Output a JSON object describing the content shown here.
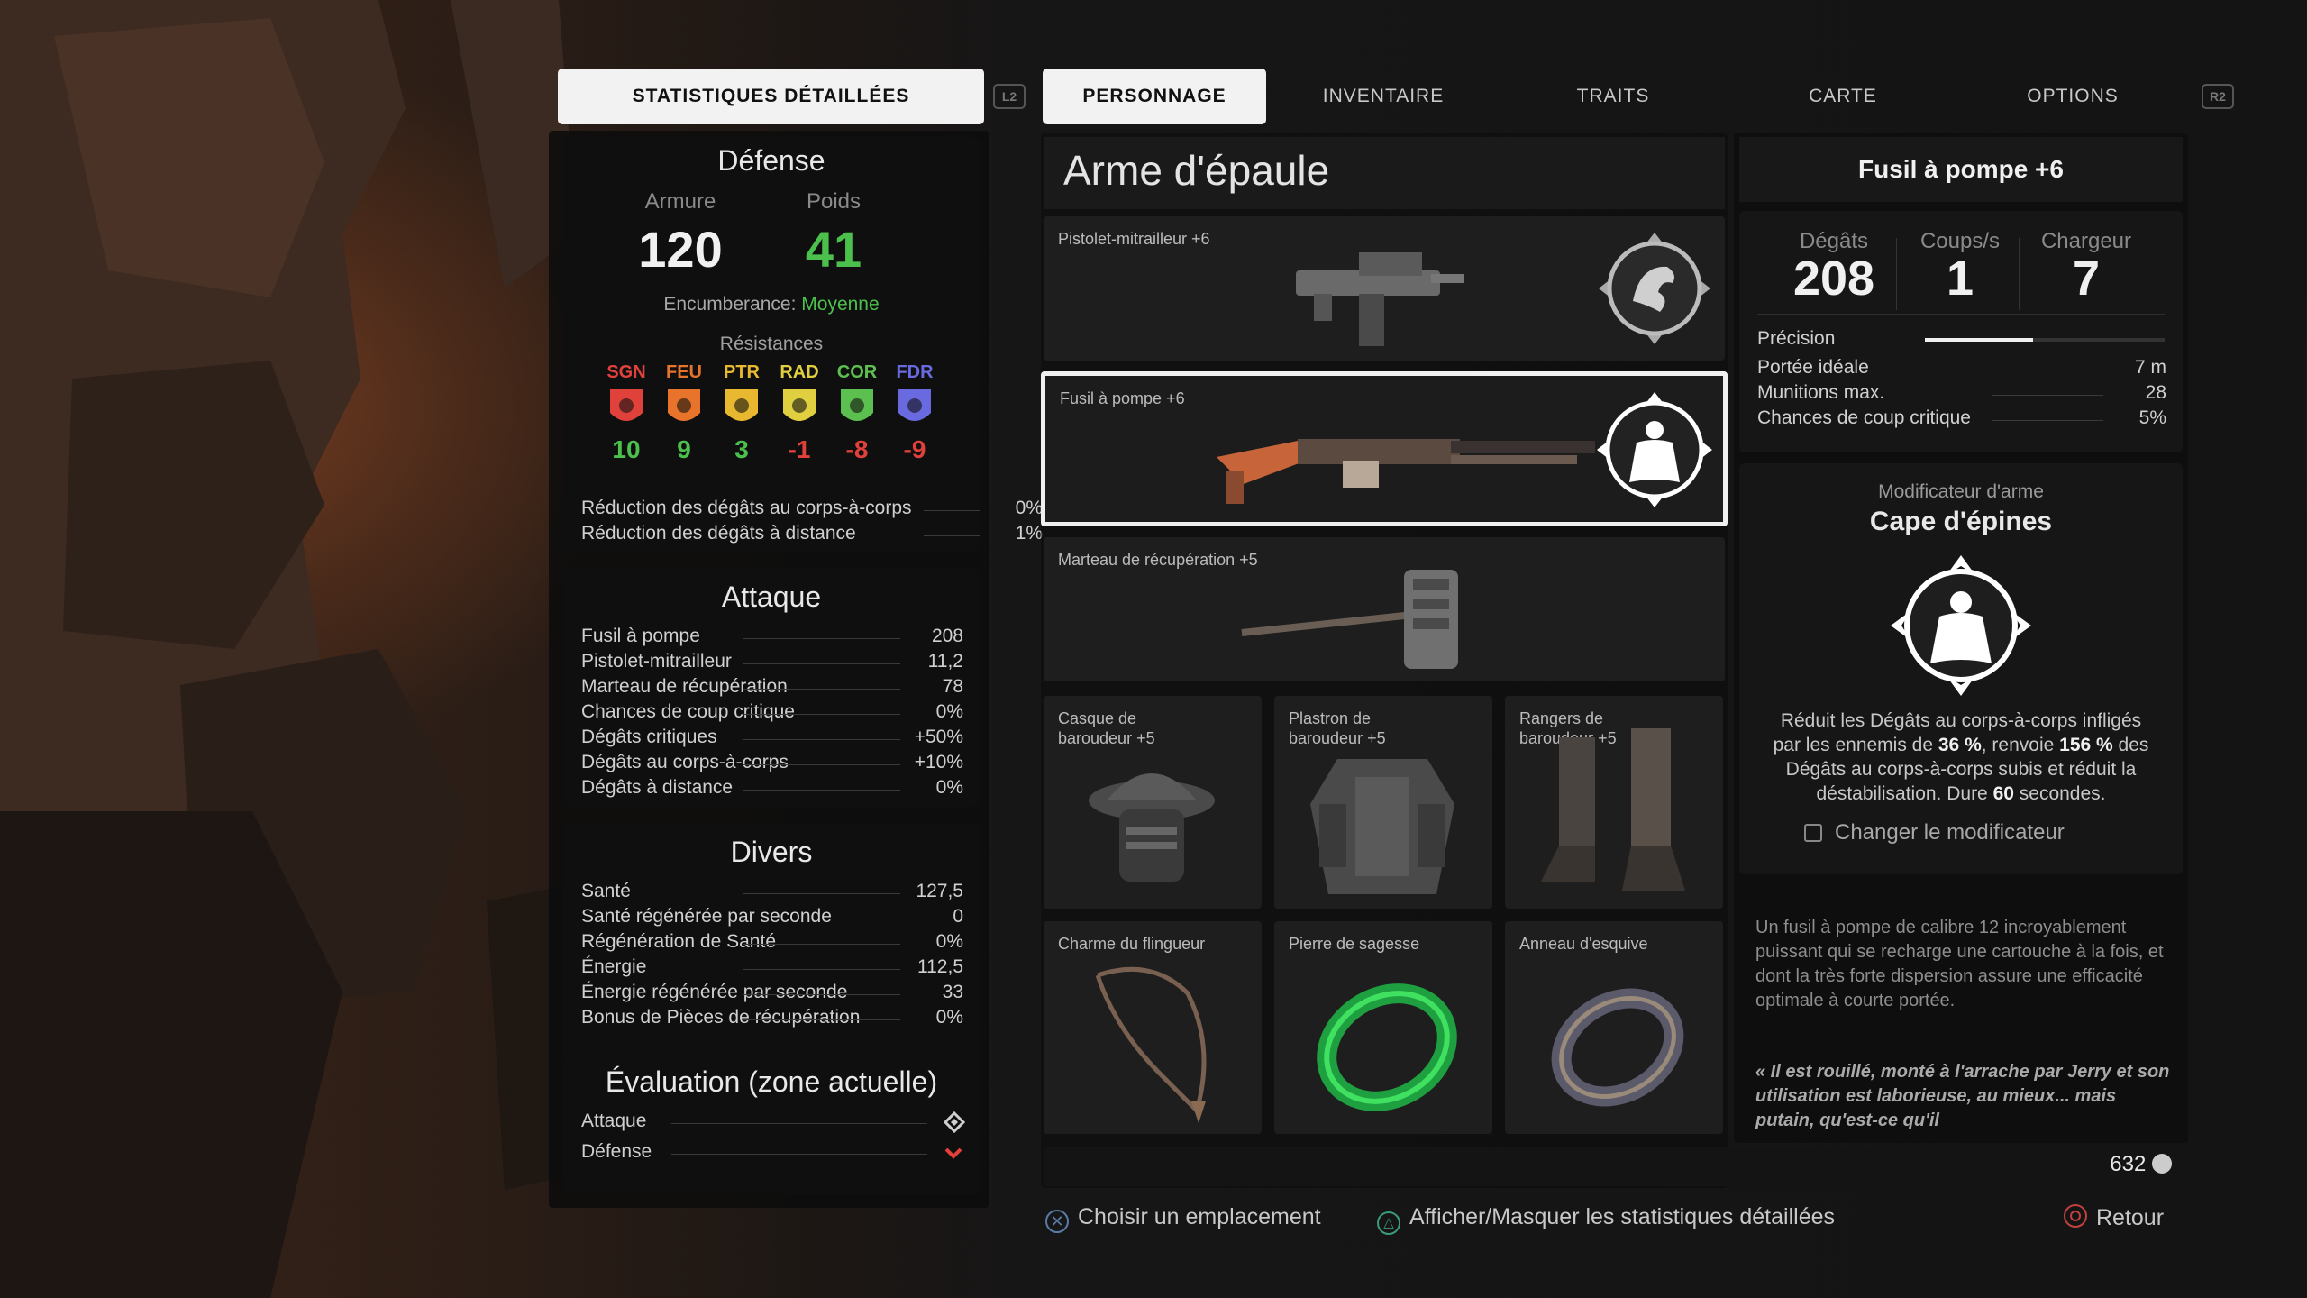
{
  "tabs": {
    "left": "STATISTIQUES DÉTAILLÉES",
    "l2": "L2",
    "items": [
      "PERSONNAGE",
      "INVENTAIRE",
      "TRAITS",
      "CARTE",
      "OPTIONS"
    ],
    "r2": "R2"
  },
  "defense": {
    "title": "Défense",
    "armor_label": "Armure",
    "armor_value": "120",
    "weight_label": "Poids",
    "weight_value": "41",
    "encumbrance_label": "Encumberance:",
    "encumbrance_value": "Moyenne",
    "resistances_title": "Résistances",
    "resistances": [
      {
        "label": "SGN",
        "value": "10",
        "color": "#e0413a",
        "value_color": "#4cc04c"
      },
      {
        "label": "FEU",
        "value": "9",
        "color": "#e8732a",
        "value_color": "#4cc04c"
      },
      {
        "label": "PTR",
        "value": "3",
        "color": "#e8b830",
        "value_color": "#4cc04c"
      },
      {
        "label": "RAD",
        "value": "-1",
        "color": "#e0d040",
        "value_color": "#e0413a"
      },
      {
        "label": "COR",
        "value": "-8",
        "color": "#5cc050",
        "value_color": "#e0413a"
      },
      {
        "label": "FDR",
        "value": "-9",
        "color": "#6a6ae0",
        "value_color": "#e0413a"
      }
    ],
    "rows": [
      {
        "label": "Réduction des dégâts au corps-à-corps",
        "value": "0%"
      },
      {
        "label": "Réduction des dégâts à distance",
        "value": "1%"
      }
    ]
  },
  "attack": {
    "title": "Attaque",
    "rows": [
      {
        "label": "Fusil à pompe",
        "value": "208"
      },
      {
        "label": "Pistolet-mitrailleur",
        "value": "11,2"
      },
      {
        "label": "Marteau de récupération",
        "value": "78"
      },
      {
        "label": "Chances de coup critique",
        "value": "0%"
      },
      {
        "label": "Dégâts critiques",
        "value": "+50%"
      },
      {
        "label": "Dégâts au corps-à-corps",
        "value": "+10%"
      },
      {
        "label": "Dégâts à distance",
        "value": "0%"
      }
    ]
  },
  "misc": {
    "title": "Divers",
    "rows": [
      {
        "label": "Santé",
        "value": "127,5"
      },
      {
        "label": "Santé régénérée par seconde",
        "value": "0"
      },
      {
        "label": "Régénération de Santé",
        "value": "0%"
      },
      {
        "label": "Énergie",
        "value": "112,5"
      },
      {
        "label": "Énergie régénérée par seconde",
        "value": "33"
      },
      {
        "label": "Bonus de Pièces de récupération",
        "value": "0%"
      }
    ]
  },
  "evaluation": {
    "title": "Évaluation (zone actuelle)",
    "rows": [
      {
        "label": "Attaque",
        "icon": "diamond-icon"
      },
      {
        "label": "Défense",
        "icon": "chevron-down-icon"
      }
    ]
  },
  "slots": {
    "title": "Arme d'épaule",
    "weapons": [
      {
        "name": "Pistolet-mitrailleur +6",
        "mod_icon": "dragon-emblem-icon"
      },
      {
        "name": "Fusil à pompe +6",
        "mod_icon": "thorn-cape-icon",
        "selected": true
      },
      {
        "name": "Marteau de récupération +5"
      }
    ],
    "armor": [
      {
        "name": "Casque de baroudeur +5",
        "icon": "helmet-icon"
      },
      {
        "name": "Plastron de baroudeur +5",
        "icon": "chestplate-icon"
      },
      {
        "name": "Rangers de baroudeur +5",
        "icon": "boots-icon"
      }
    ],
    "accessories": [
      {
        "name": "Charme du flingueur",
        "icon": "amulet-icon"
      },
      {
        "name": "Pierre de sagesse",
        "icon": "green-ring-icon"
      },
      {
        "name": "Anneau d'esquive",
        "icon": "ring-icon"
      }
    ],
    "scrap": "632"
  },
  "detail": {
    "title": "Fusil à pompe +6",
    "damage_label": "Dégâts",
    "damage_value": "208",
    "rof_label": "Coups/s",
    "rof_value": "1",
    "mag_label": "Chargeur",
    "mag_value": "7",
    "accuracy_label": "Précision",
    "accuracy_fraction": 0.45,
    "rows": [
      {
        "label": "Portée idéale",
        "value": "7 m"
      },
      {
        "label": "Munitions max.",
        "value": "28"
      },
      {
        "label": "Chances de coup critique",
        "value": "5%"
      }
    ],
    "mod_header": "Modificateur d'arme",
    "mod_name": "Cape d'épines",
    "mod_desc_1": "Réduit les Dégâts au corps-à-corps infligés",
    "mod_desc_2a": "par les ennemis de ",
    "mod_desc_2b": "36 %",
    "mod_desc_2c": ", renvoie ",
    "mod_desc_2d": "156 %",
    "mod_desc_2e": " des",
    "mod_desc_3": "Dégâts au corps-à-corps subis et réduit la",
    "mod_desc_4a": "déstabilisation. Dure ",
    "mod_desc_4b": "60",
    "mod_desc_4c": " secondes.",
    "change_mod": "Changer le modificateur",
    "description": "Un fusil à pompe de calibre 12 incroyablement puissant qui se recharge une cartouche à la fois, et dont la très forte dispersion assure une efficacité optimale à courte portée.",
    "quote": "« Il est rouillé, monté à l'arrache par Jerry et son utilisation est laborieuse, au mieux... mais putain, qu'est-ce qu'il"
  },
  "footer": {
    "choose": "Choisir un emplacement",
    "toggle": "Afficher/Masquer les statistiques détaillées",
    "back": "Retour"
  }
}
